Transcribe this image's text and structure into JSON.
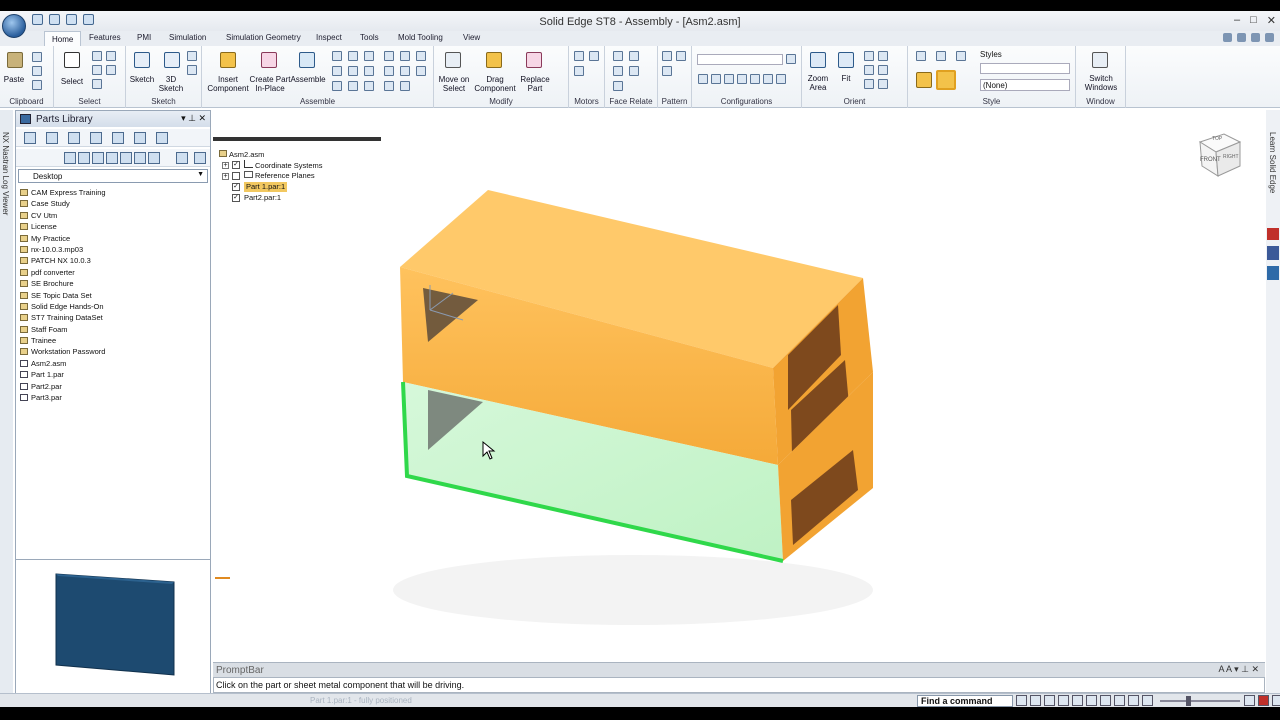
{
  "window": {
    "title": "Solid Edge ST8 - Assembly - [Asm2.asm]"
  },
  "ribbon_tabs": [
    "Home",
    "Features",
    "PMI",
    "Simulation",
    "Simulation Geometry",
    "Inspect",
    "Tools",
    "Mold Tooling",
    "View"
  ],
  "groups": {
    "clipboard": {
      "label": "Clipboard",
      "paste": "Paste"
    },
    "select": {
      "label": "Select",
      "select": "Select"
    },
    "sketch": {
      "label": "Sketch",
      "sketch": "Sketch",
      "sketch3d": "3D Sketch"
    },
    "assemble": {
      "label": "Assemble",
      "insert": "Insert Component",
      "create_part": "Create Part In-Place",
      "assemble": "Assemble"
    },
    "modify": {
      "label": "Modify",
      "move": "Move on Select",
      "drag": "Drag Component",
      "replace": "Replace Part"
    },
    "motors": {
      "label": "Motors"
    },
    "face_relate": {
      "label": "Face Relate"
    },
    "pattern": {
      "label": "Pattern"
    },
    "configurations": {
      "label": "Configurations"
    },
    "orient": {
      "label": "Orient",
      "zoom_area": "Zoom Area",
      "fit": "Fit"
    },
    "style": {
      "label": "Style",
      "styles": "Styles",
      "none_value": "(None)"
    },
    "window": {
      "label": "Window",
      "switch": "Switch Windows"
    }
  },
  "left_strip": {
    "label": "NX Nastran Log Viewer"
  },
  "right_strip": {
    "label": "Learn Solid Edge"
  },
  "parts_library": {
    "title": "Parts Library",
    "location": "Desktop",
    "items": [
      {
        "name": "CAM Express Training",
        "type": "folder"
      },
      {
        "name": "Case Study",
        "type": "folder"
      },
      {
        "name": "CV Utm",
        "type": "folder"
      },
      {
        "name": "License",
        "type": "folder"
      },
      {
        "name": "My Practice",
        "type": "folder"
      },
      {
        "name": "nx-10.0.3.mp03",
        "type": "folder"
      },
      {
        "name": "PATCH NX 10.0.3",
        "type": "folder"
      },
      {
        "name": "pdf converter",
        "type": "folder"
      },
      {
        "name": "SE Brochure",
        "type": "folder"
      },
      {
        "name": "SE Topic Data Set",
        "type": "folder"
      },
      {
        "name": "Solid Edge Hands-On",
        "type": "folder"
      },
      {
        "name": "ST7 Training DataSet",
        "type": "folder"
      },
      {
        "name": "Staff Foam",
        "type": "folder"
      },
      {
        "name": "Trainee",
        "type": "folder"
      },
      {
        "name": "Workstation Password",
        "type": "folder"
      },
      {
        "name": "Asm2.asm",
        "type": "file"
      },
      {
        "name": "Part 1.par",
        "type": "file"
      },
      {
        "name": "Part2.par",
        "type": "file"
      },
      {
        "name": "Part3.par",
        "type": "file"
      }
    ]
  },
  "pathfinder": {
    "root": "Asm2.asm",
    "coord": "Coordinate Systems",
    "ref_planes": "Reference Planes",
    "part1": "Part 1.par:1",
    "part2": "Part2.par:1"
  },
  "view_cube": {
    "top": "TOP",
    "front": "FRONT",
    "right": "RIGHT"
  },
  "promptbar": {
    "title": "PromptBar",
    "message": "Click on the part or sheet metal component that will be driving."
  },
  "status": {
    "find": "Find a command",
    "part_status": "Part 1.par:1 - fully positioned"
  },
  "colors": {
    "part1": "#f6a530",
    "part2": "#c6f5cc",
    "highlight": "#2fd84a",
    "preview": "#1d4a70"
  }
}
